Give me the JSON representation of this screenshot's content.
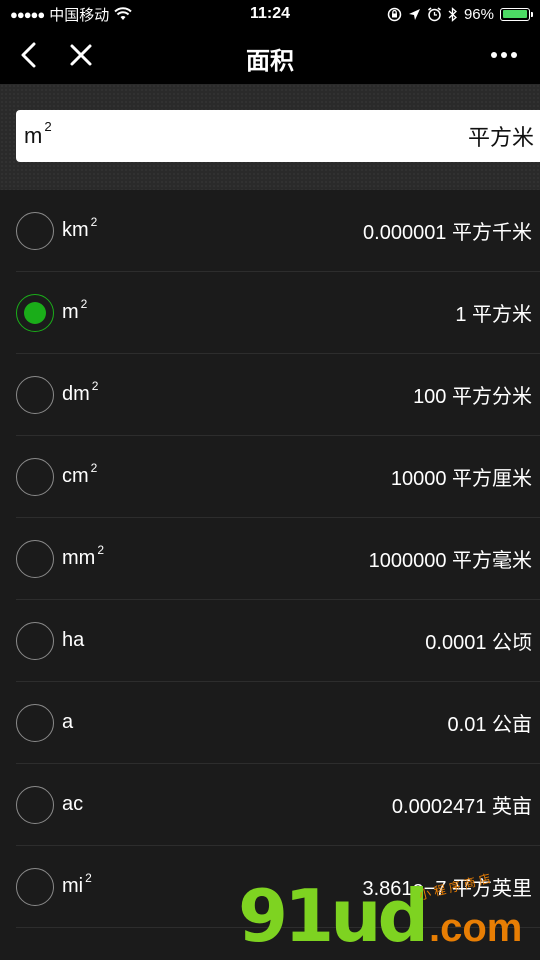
{
  "status_bar": {
    "signal": "●●●●●",
    "carrier": "中国移动",
    "time": "11:24",
    "battery_text": "96%",
    "battery_level": 0.96,
    "battery_color": "#4cd964"
  },
  "nav": {
    "title": "面积"
  },
  "input": {
    "unit_base": "m",
    "unit_exp": "2",
    "unit_name": "平方米"
  },
  "units": [
    {
      "base": "km",
      "exp": "2",
      "value": "0.000001 平方千米",
      "checked": false
    },
    {
      "base": "m",
      "exp": "2",
      "value": "1 平方米",
      "checked": true
    },
    {
      "base": "dm",
      "exp": "2",
      "value": "100 平方分米",
      "checked": false
    },
    {
      "base": "cm",
      "exp": "2",
      "value": "10000 平方厘米",
      "checked": false
    },
    {
      "base": "mm",
      "exp": "2",
      "value": "1000000 平方毫米",
      "checked": false
    },
    {
      "base": "ha",
      "exp": "",
      "value": "0.0001 公顷",
      "checked": false
    },
    {
      "base": "a",
      "exp": "",
      "value": "0.01 公亩",
      "checked": false
    },
    {
      "base": "ac",
      "exp": "",
      "value": "0.0002471 英亩",
      "checked": false
    },
    {
      "base": "mi",
      "exp": "2",
      "value": "3.861e−7 平方英里",
      "checked": false
    }
  ],
  "watermark": {
    "main": "91ud",
    "dot_com": ".com",
    "tagline": "小 程 序 商 店"
  },
  "colors": {
    "accent": "#1aad19",
    "background": "#1b1b1b"
  }
}
